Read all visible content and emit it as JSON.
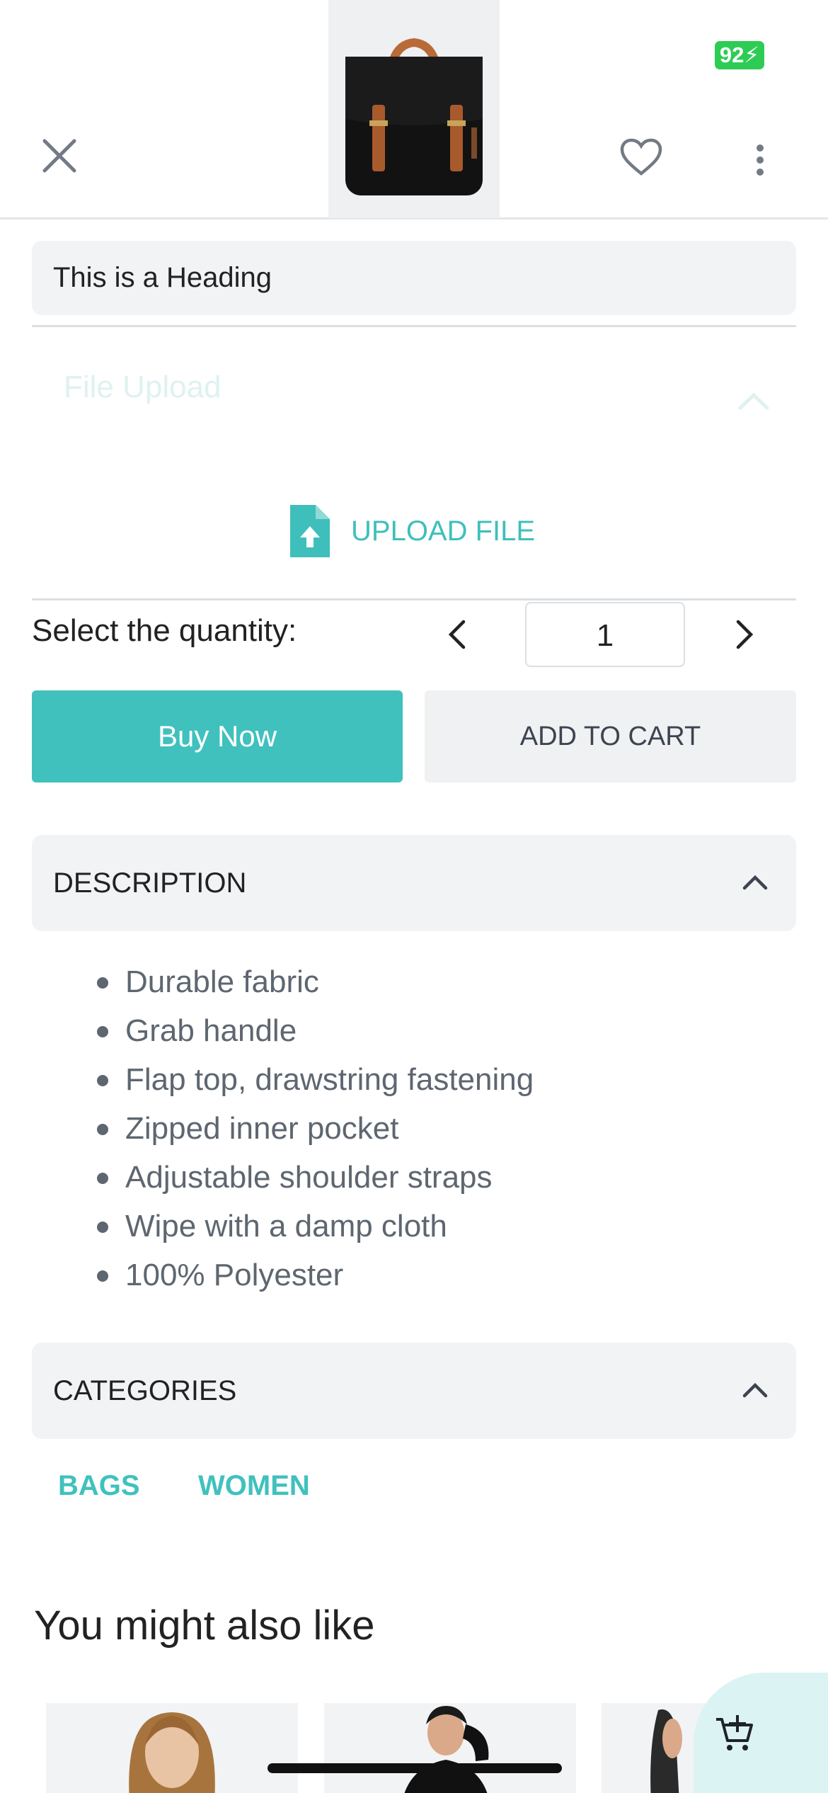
{
  "status": {
    "battery": "92"
  },
  "header": {
    "close_icon": "close-icon",
    "favorite_icon": "heart-icon",
    "more_icon": "more-vert-icon",
    "product_image": "black-backpack-image"
  },
  "product": {
    "heading": "This is a Heading"
  },
  "upload": {
    "label": "File Upload",
    "button_label": "UPLOAD FILE",
    "icon": "file-upload-icon"
  },
  "quantity": {
    "label": "Select the quantity:",
    "value": "1"
  },
  "actions": {
    "buy_now": "Buy Now",
    "add_to_cart": "ADD TO CART"
  },
  "description": {
    "title": "DESCRIPTION",
    "items": [
      "Durable fabric",
      "Grab handle",
      "Flap top, drawstring fastening",
      "Zipped inner pocket",
      "Adjustable shoulder straps",
      "Wipe with a damp cloth",
      "100% Polyester"
    ]
  },
  "categories": {
    "title": "CATEGORIES",
    "items": [
      "BAGS",
      "WOMEN"
    ]
  },
  "related": {
    "title": "You might also like"
  },
  "colors": {
    "accent": "#40c1bd",
    "battery": "#2ecc55",
    "panel": "#f2f3f5"
  }
}
